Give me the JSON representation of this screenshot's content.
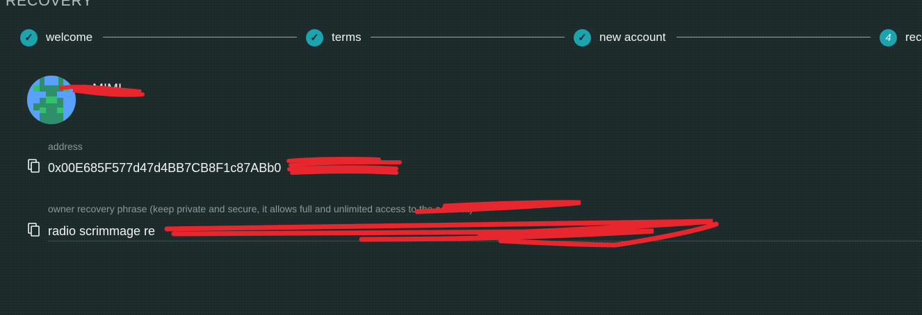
{
  "window": {
    "title": "RECOVERY"
  },
  "steps": [
    {
      "label": "welcome",
      "state": "done",
      "icon": "check-icon"
    },
    {
      "label": "terms",
      "state": "done",
      "icon": "check-icon"
    },
    {
      "label": "new account",
      "state": "done",
      "icon": "check-icon"
    },
    {
      "label": "rec",
      "state": "active",
      "number": "4"
    }
  ],
  "account": {
    "name": "MIMI",
    "avatar_colors": [
      "#2f8f6b",
      "#5aa1ff",
      "#32c36a"
    ]
  },
  "address": {
    "label": "address",
    "value": "0x00E685F577d47d4BB7CB8F1c87ABb0"
  },
  "phrase": {
    "label": "owner recovery phrase (keep private and secure, it allows full and unlimited access to the account)",
    "value": "radio scrimmage re"
  },
  "colors": {
    "accent": "#1ba3ae",
    "background": "#1d2a2b",
    "redaction": "#e8262e"
  }
}
